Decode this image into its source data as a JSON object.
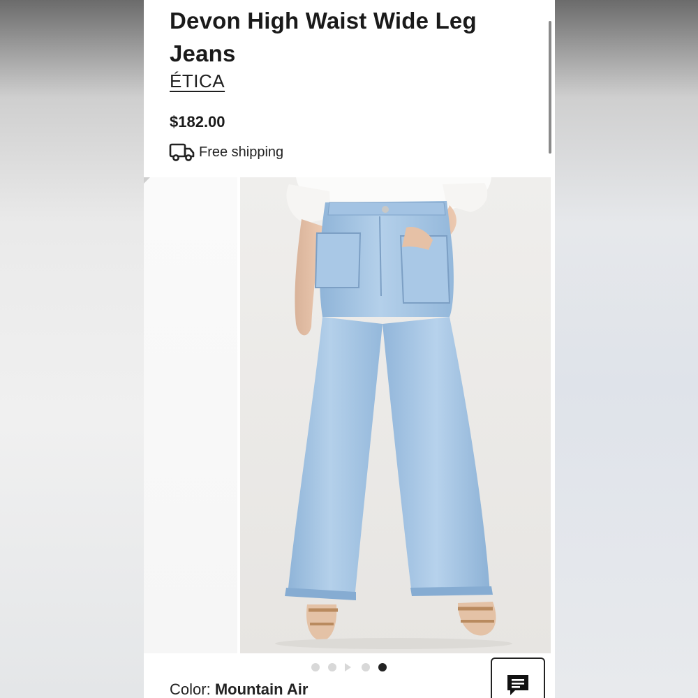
{
  "product": {
    "title": "Devon High Waist Wide Leg Jeans",
    "brand": "ÉTICA",
    "price": "$182.00",
    "shipping": "Free shipping"
  },
  "gallery": {
    "dot_count": 5,
    "active_dot": 5
  },
  "options": {
    "color_label": "Color:",
    "color_value": "Mountain Air"
  },
  "icons": {
    "shipping": "truck-icon",
    "chat": "chat-icon"
  },
  "colors": {
    "text": "#1a1a1a",
    "denim": "#a9c8e6",
    "background": "#ffffff"
  }
}
